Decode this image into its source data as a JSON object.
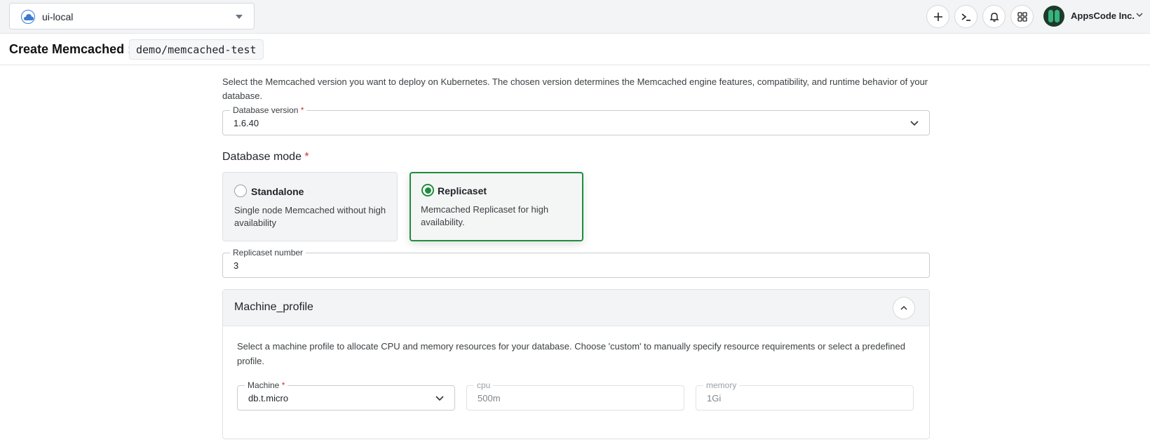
{
  "topbar": {
    "cluster_name": "ui-local",
    "org_name": "AppsCode Inc."
  },
  "header": {
    "title": "Create Memcached :",
    "path": "demo/memcached-test"
  },
  "form": {
    "version_description": "Select the Memcached version you want to deploy on Kubernetes. The chosen version determines the Memcached engine features, compatibility, and runtime behavior of your database.",
    "version_label": "Database version",
    "version_value": "1.6.40",
    "mode_heading": "Database mode",
    "modes": [
      {
        "title": "Standalone",
        "description": "Single node Memcached without high availability",
        "selected": false
      },
      {
        "title": "Replicaset",
        "description": "Memcached Replicaset for high availability.",
        "selected": true
      }
    ],
    "replicas_label": "Replicaset number",
    "replicas_value": "3",
    "machine_profile": {
      "title": "Machine_profile",
      "description": "Select a machine profile to allocate CPU and memory resources for your database. Choose 'custom' to manually specify resource requirements or select a predefined profile.",
      "machine_label": "Machine",
      "machine_value": "db.t.micro",
      "cpu_label": "cpu",
      "cpu_value": "500m",
      "memory_label": "memory",
      "memory_value": "1Gi"
    }
  },
  "required_mark": "*",
  "colors": {
    "accent_green": "#1e8e3e",
    "required_red": "#d32f2f"
  },
  "icons": [
    "cloud-icon",
    "plus-icon",
    "terminal-icon",
    "bell-icon",
    "apps-grid-icon",
    "chevron-down-icon",
    "chevron-up-icon"
  ]
}
